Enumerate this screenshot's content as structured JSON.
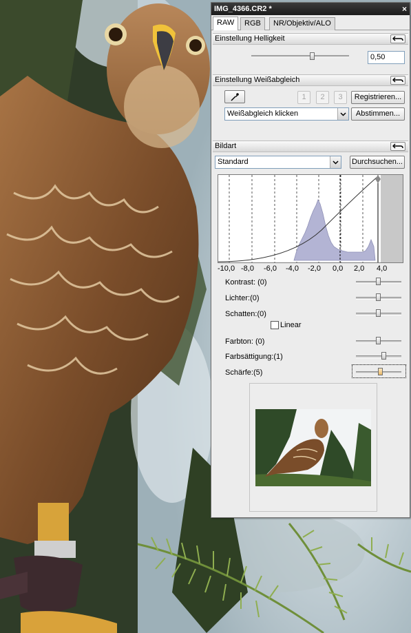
{
  "window": {
    "title": "IMG_4366.CR2 *",
    "close_glyph": "×"
  },
  "tabs": [
    {
      "label": "RAW",
      "active": true
    },
    {
      "label": "RGB",
      "active": false
    },
    {
      "label": "NR/Objektiv/ALO",
      "active": false
    }
  ],
  "brightness": {
    "title": "Einstellung Helligkeit",
    "value": "0,50",
    "slider_level": 0.63
  },
  "white_balance": {
    "title": "Einstellung Weißabgleich",
    "buttons": [
      "1",
      "2",
      "3"
    ],
    "register_label": "Registrieren...",
    "mode_value": "Weißabgleich klicken",
    "adjust_label": "Abstimmen..."
  },
  "picture_style": {
    "title": "Bildart",
    "value": "Standard",
    "browse_label": "Durchsuchen...",
    "histogram": {
      "x_ticks": [
        "-10,0",
        "-8,0",
        "-6,0",
        "-4,0",
        "-2,0",
        "0,0",
        "2,0",
        "4,0"
      ]
    },
    "sliders": [
      {
        "label": "Kontrast: (0)",
        "level": 0.5
      },
      {
        "label": "Lichter:(0)",
        "level": 0.5
      },
      {
        "label": "Schatten:(0)",
        "level": 0.5
      },
      {
        "label": "Farbton: (0)",
        "level": 0.5
      },
      {
        "label": "Farbsättigung:(1)",
        "level": 0.62
      },
      {
        "label": "Schärfe:(5)",
        "level": 0.55
      }
    ],
    "linear_label": "Linear",
    "linear_checked": false
  },
  "icons": {
    "reset": "undo-arrow-icon",
    "eyedropper": "eyedropper-icon",
    "dropdown": "chevron-down-icon"
  },
  "colors": {
    "titlebar": "#262626",
    "histogram_fill": "#b3b4d4",
    "panel": "#ececec"
  }
}
